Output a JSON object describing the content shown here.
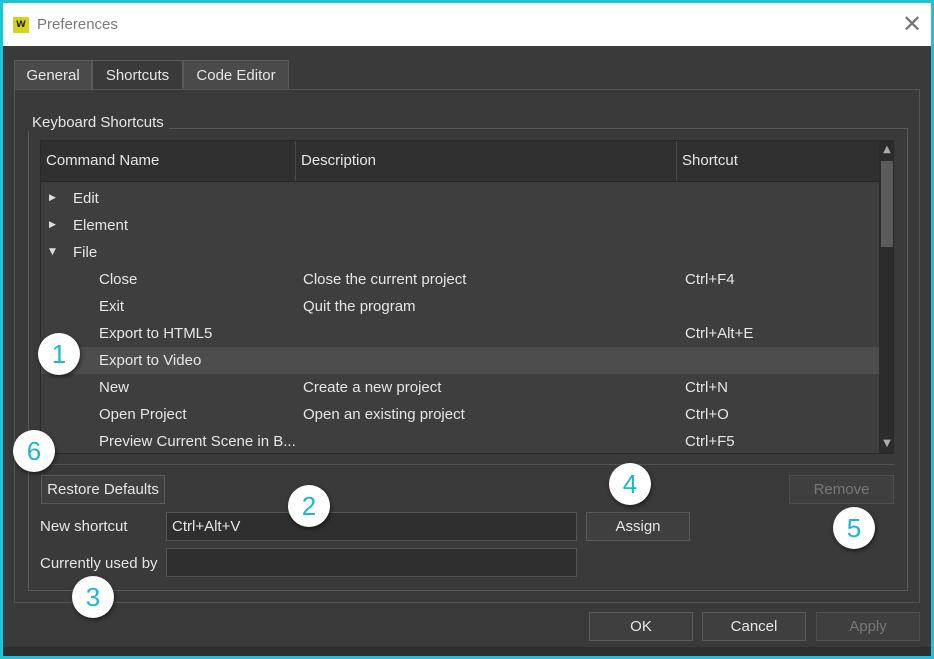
{
  "window": {
    "title": "Preferences",
    "logo_text": "W",
    "close_glyph": "✕"
  },
  "tabs": [
    {
      "label": "General",
      "active": false
    },
    {
      "label": "Shortcuts",
      "active": true
    },
    {
      "label": "Code Editor",
      "active": false
    }
  ],
  "group": {
    "title": "Keyboard Shortcuts"
  },
  "table": {
    "columns": [
      "Command Name",
      "Description",
      "Shortcut"
    ],
    "rows": [
      {
        "name": "Edit",
        "description": "",
        "shortcut": "",
        "level": 0,
        "expanded": false,
        "selected": false
      },
      {
        "name": "Element",
        "description": "",
        "shortcut": "",
        "level": 0,
        "expanded": false,
        "selected": false
      },
      {
        "name": "File",
        "description": "",
        "shortcut": "",
        "level": 0,
        "expanded": true,
        "selected": false
      },
      {
        "name": "Close",
        "description": "Close the current project",
        "shortcut": "Ctrl+F4",
        "level": 1,
        "selected": false
      },
      {
        "name": "Exit",
        "description": "Quit the program",
        "shortcut": "",
        "level": 1,
        "selected": false
      },
      {
        "name": "Export to HTML5",
        "description": "",
        "shortcut": "Ctrl+Alt+E",
        "level": 1,
        "selected": false
      },
      {
        "name": "Export to Video",
        "description": "",
        "shortcut": "",
        "level": 1,
        "selected": true
      },
      {
        "name": "New",
        "description": "Create a new project",
        "shortcut": "Ctrl+N",
        "level": 1,
        "selected": false
      },
      {
        "name": "Open Project",
        "description": "Open an existing project",
        "shortcut": "Ctrl+O",
        "level": 1,
        "selected": false
      },
      {
        "name": "Preview Current Scene in B...",
        "description": "",
        "shortcut": "Ctrl+F5",
        "level": 1,
        "selected": false
      }
    ],
    "scroll_up_glyph": "▲",
    "scroll_down_glyph": "▼"
  },
  "controls": {
    "restore_defaults": "Restore Defaults",
    "remove": "Remove",
    "new_shortcut_label": "New shortcut",
    "new_shortcut_value": "Ctrl+Alt+V",
    "currently_used_by_label": "Currently used by",
    "currently_used_by_value": "",
    "assign": "Assign"
  },
  "footer": {
    "ok": "OK",
    "cancel": "Cancel",
    "apply": "Apply"
  },
  "callouts": [
    "1",
    "2",
    "3",
    "4",
    "5",
    "6"
  ],
  "colors": {
    "frame": "#1fc3d9",
    "background": "#3a3a3a",
    "callout_text": "#1fb6cf"
  }
}
